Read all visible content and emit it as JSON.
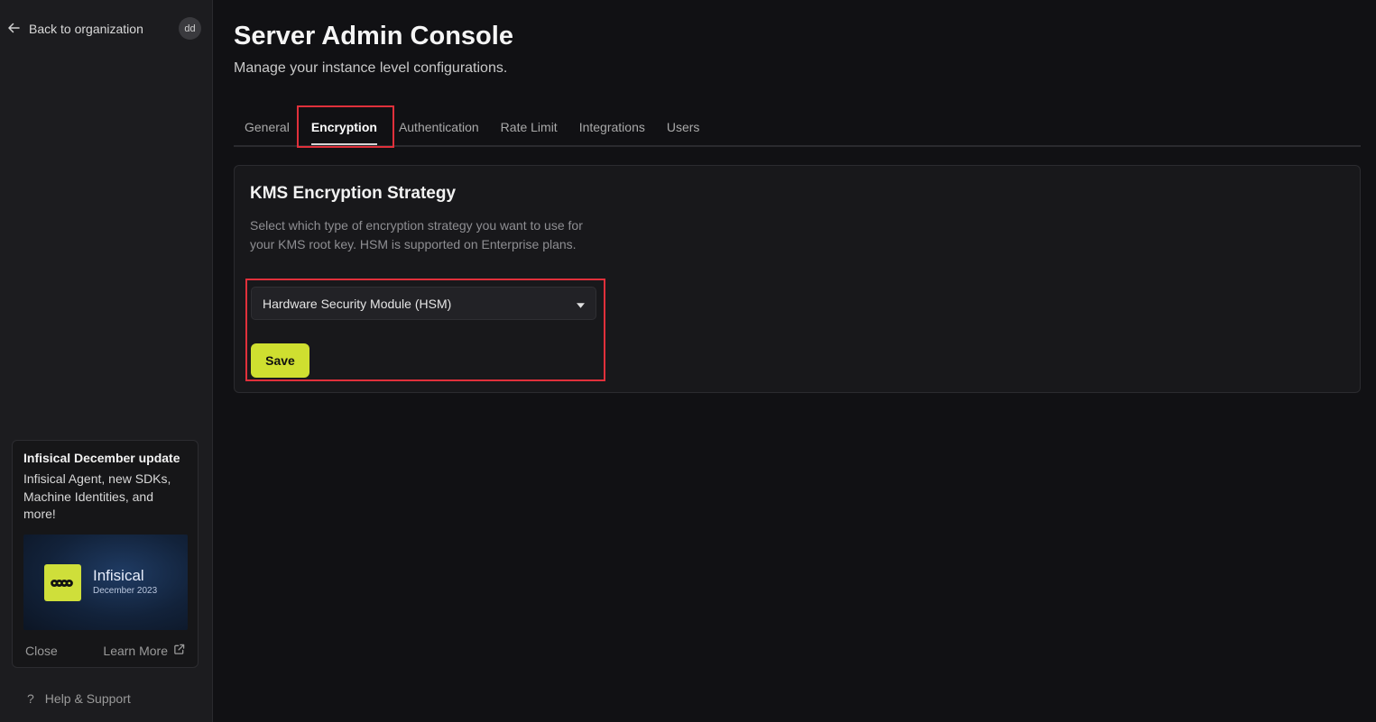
{
  "sidebar": {
    "back_label": "Back to organization",
    "avatar_initials": "dd",
    "update_card": {
      "title": "Infisical December update",
      "description": "Infisical Agent, new SDKs, Machine Identities, and more!",
      "image_brand": "Infisical",
      "image_date": "December 2023",
      "close_label": "Close",
      "learn_more_label": "Learn More"
    },
    "help_label": "Help & Support"
  },
  "header": {
    "title": "Server Admin Console",
    "subtitle": "Manage your instance level configurations."
  },
  "tabs": [
    {
      "label": "General",
      "active": false
    },
    {
      "label": "Encryption",
      "active": true
    },
    {
      "label": "Authentication",
      "active": false
    },
    {
      "label": "Rate Limit",
      "active": false
    },
    {
      "label": "Integrations",
      "active": false
    },
    {
      "label": "Users",
      "active": false
    }
  ],
  "kms": {
    "title": "KMS Encryption Strategy",
    "description": "Select which type of encryption strategy you want to use for your KMS root key. HSM is supported on Enterprise plans.",
    "selected_strategy": "Hardware Security Module (HSM)",
    "save_label": "Save"
  },
  "colors": {
    "accent": "#cfdf30",
    "highlight": "#e0303b",
    "background": "#111114"
  }
}
